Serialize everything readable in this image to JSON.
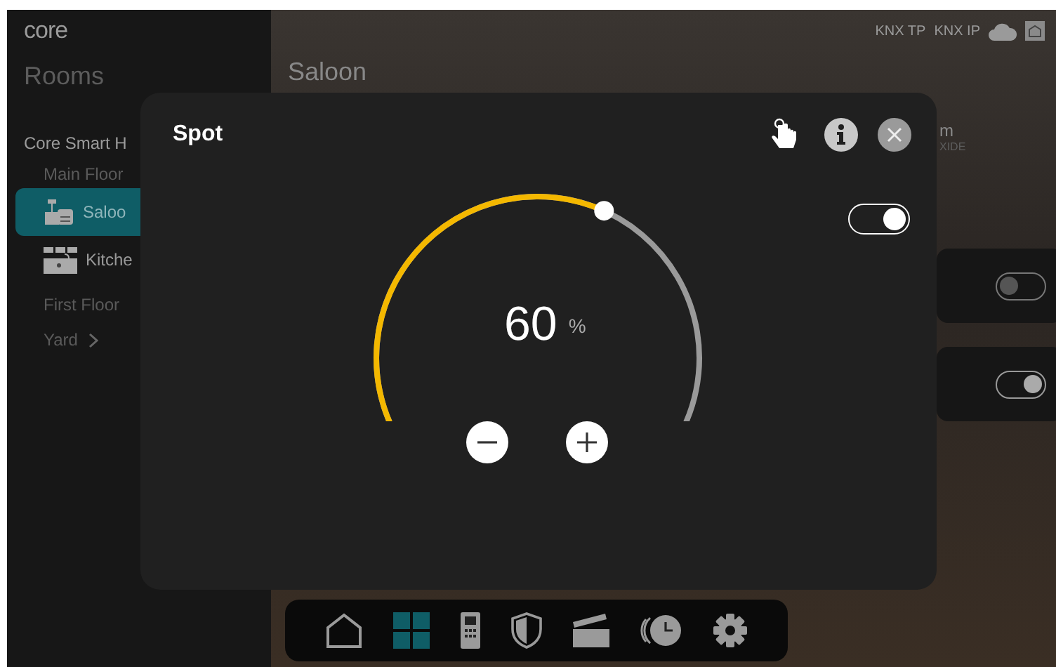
{
  "sidebar": {
    "logo": "core",
    "title": "Rooms",
    "home": "Core Smart H",
    "items": [
      {
        "kind": "group",
        "label": "Main Floor",
        "selected": false
      },
      {
        "kind": "lounge",
        "label": "Saloo",
        "selected": true
      },
      {
        "kind": "kitchen",
        "label": "Kitche",
        "selected": false
      },
      {
        "kind": "group",
        "label": "First Floor",
        "selected": false
      },
      {
        "kind": "expand",
        "label": "Yard",
        "selected": false
      }
    ]
  },
  "header": {
    "title": "Saloon",
    "status": [
      "KNX TP",
      "KNX IP"
    ]
  },
  "background_cards": {
    "texts": [
      "m",
      "XIDE"
    ],
    "toggles": [
      {
        "on": false
      },
      {
        "on": true
      }
    ]
  },
  "dialog": {
    "title": "Spot",
    "toggle": {
      "on": true
    },
    "dial": {
      "level": 0.6,
      "value": "60",
      "unit": "%"
    }
  },
  "nav": [
    {
      "kind": "home",
      "selected": false
    },
    {
      "kind": "rooms",
      "selected": true
    },
    {
      "kind": "intercom",
      "selected": false
    },
    {
      "kind": "security",
      "selected": false
    },
    {
      "kind": "scenes",
      "selected": false
    },
    {
      "kind": "timers",
      "selected": false
    },
    {
      "kind": "settings",
      "selected": false
    }
  ]
}
